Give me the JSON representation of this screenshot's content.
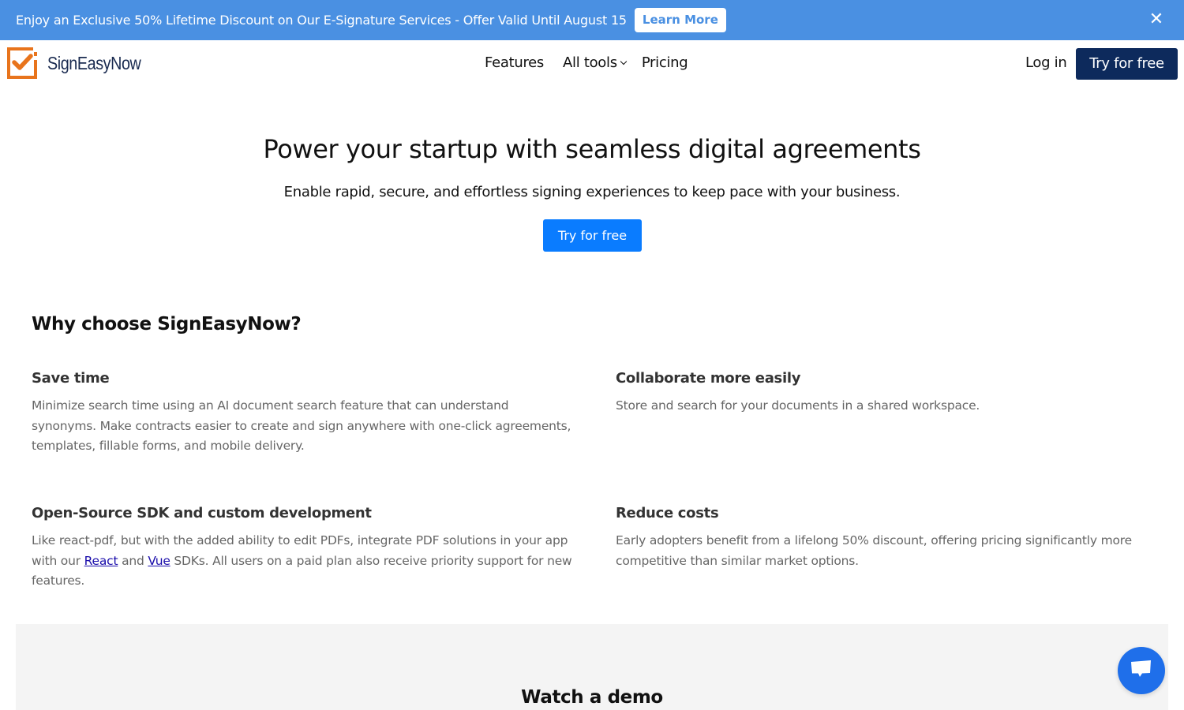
{
  "promo_banner": {
    "text": "Enjoy an Exclusive 50% Lifetime Discount on Our E-Signature Services - Offer Valid Until August 15",
    "button_label": "Learn More",
    "close_icon": "close-icon",
    "background_color": "#4a90e2"
  },
  "nav": {
    "logo_text": "SignEasyNow",
    "logo_icon": "checkbox-check-icon",
    "links": [
      {
        "label": "Features"
      },
      {
        "label": "All tools",
        "icon": "chevron-down-icon"
      },
      {
        "label": "Pricing"
      }
    ],
    "login_label": "Log in",
    "cta_label": "Try for free",
    "cta_color": "#0d2a5c"
  },
  "hero": {
    "title": "Power your startup with seamless digital agreements",
    "subtitle": "Enable rapid, secure, and effortless signing experiences to keep pace with your business.",
    "cta_label": "Try for free",
    "cta_color": "#0a7cff"
  },
  "why": {
    "title": "Why choose SignEasyNow?",
    "features": [
      {
        "title": "Save time",
        "description": "Minimize search time using an AI document search feature that can understand synonyms. Make contracts easier to create and sign anywhere with one-click agreements, templates, fillable forms, and mobile delivery."
      },
      {
        "title": "Collaborate more easily",
        "description": "Store and search for your documents in a shared workspace."
      },
      {
        "title": "Open-Source SDK and custom development",
        "description_parts": {
          "before": "Like react-pdf, but with the added ability to edit PDFs, integrate PDF solutions in your app with our ",
          "link1": "React",
          "middle": " and ",
          "link2": "Vue",
          "after": " SDKs. All users on a paid plan also receive priority support for new features."
        }
      },
      {
        "title": "Reduce costs",
        "description": "Early adopters benefit from a lifelong 50% discount, offering pricing significantly more competitive than similar market options."
      }
    ]
  },
  "demo": {
    "title": "Watch a demo"
  },
  "chat_widget": {
    "icon": "chat-bubble-icon",
    "color": "#1f6fea"
  }
}
